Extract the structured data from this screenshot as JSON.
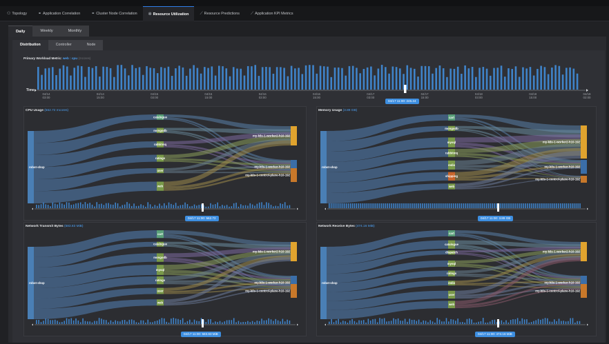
{
  "tabs": [
    {
      "icon": "topology-icon",
      "glyph": "⚇",
      "label": "Topology"
    },
    {
      "icon": "app-correlation-icon",
      "glyph": "⚭",
      "label": "Application Correlation"
    },
    {
      "icon": "cluster-correlation-icon",
      "glyph": "⚭",
      "label": "Cluster Node Correlation"
    },
    {
      "icon": "resource-utilization-icon",
      "glyph": "✲",
      "label": "Resource Utilization"
    },
    {
      "icon": "prediction-chart-icon",
      "glyph": "⟋",
      "label": "Resource Predictions"
    },
    {
      "icon": "kpi-chart-icon",
      "glyph": "⟋",
      "label": "Application KPI Metrics"
    }
  ],
  "active_tab": 3,
  "period_tabs": [
    "Daily",
    "Weekly",
    "Monthly"
  ],
  "view_tabs": [
    "Distribution",
    "Controller",
    "Node"
  ],
  "primary": {
    "label": "Primary Workload Metric:",
    "metric": "web : cpu",
    "unit": "(mcores)",
    "time_label": "Time",
    "ticks": [
      [
        "04/14",
        "03:00"
      ],
      [
        "04/14",
        "15:00"
      ],
      [
        "04/15",
        "03:00"
      ],
      [
        "04/15",
        "15:00"
      ],
      [
        "04/16",
        "03:00"
      ],
      [
        "04/16",
        "15:00"
      ],
      [
        "04/17",
        "03:00"
      ],
      [
        "04/17",
        "15:00"
      ],
      [
        "04/18",
        "03:00"
      ],
      [
        "04/18",
        "15:00"
      ],
      [
        "04/19",
        "02:00"
      ]
    ],
    "selected": "04/17 11:00: 245.24"
  },
  "cards": [
    {
      "title": "CPU Usage",
      "value": "(562.72 mcores)",
      "badge": "04/17 11:00: 562.72",
      "source": "robot-shop",
      "mids": [
        "catalogue",
        "mongodb",
        "rabbitmq",
        "ratings",
        "user",
        "web"
      ],
      "targets": [
        "my-k8s-1-worker2-h10-192",
        "my-k8s-1-worker-h10-192",
        "my-k8s-1-control-plane-h10-192"
      ]
    },
    {
      "title": "Memory Usage",
      "value": "(3.89 GB)",
      "badge": "04/17 11:00: 3.89 GB",
      "source": "robot-shop",
      "mids": [
        "cart",
        "mongodb",
        "mysql",
        "rabbitmq",
        "redis",
        "shipping",
        "web"
      ],
      "targets": [
        "my-k8s-1-worker2-h10-192",
        "my-k8s-1-worker-h10-192",
        "my-k8s-1-control-plane-h10-192"
      ]
    },
    {
      "title": "Network Transmit Bytes",
      "value": "(583.83 MiB)",
      "badge": "04/17 11:00: 583.83 MiB",
      "source": "robot-shop",
      "mids": [
        "cart",
        "catalogue",
        "mongodb",
        "mysql",
        "ratings",
        "user",
        "web"
      ],
      "targets": [
        "my-k8s-1-worker2-h10-192",
        "my-k8s-1-worker-h10-192",
        "my-k8s-1-control-plane-h10-192"
      ]
    },
    {
      "title": "Network Receive Bytes",
      "value": "(474.16 MiB)",
      "badge": "04/17 11:00: 474.16 MiB",
      "source": "robot-shop",
      "mids": [
        "cart",
        "catalogue",
        "dispatch",
        "mysql",
        "ratings",
        "redis",
        "user",
        "web"
      ],
      "targets": [
        "my-k8s-1-worker2-h10-192",
        "my-k8s-1-worker-h10-192",
        "my-k8s-1-control-plane-h10-192"
      ]
    }
  ],
  "colors": {
    "accent": "#3d8ee0",
    "source": "#4a7fb5",
    "target_orange": "#e0a32e",
    "target_blue": "#3b6ea8",
    "target_brown": "#c8782a"
  }
}
